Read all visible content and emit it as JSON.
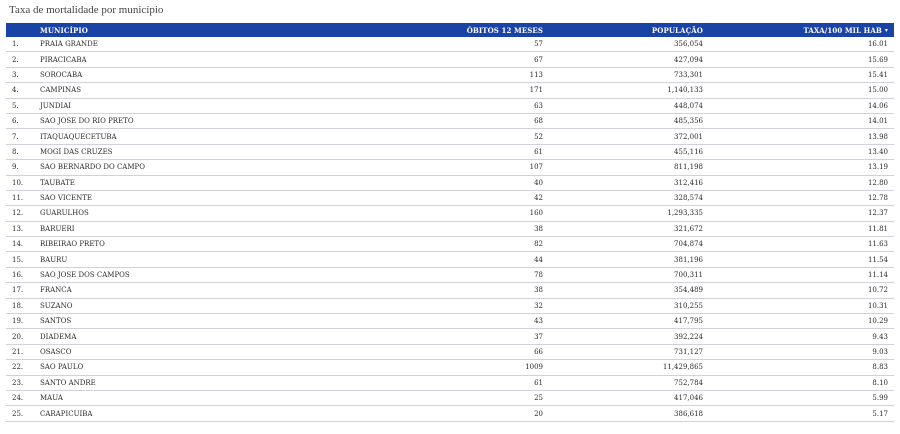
{
  "title": "Taxa de mortalidade por município",
  "table": {
    "headers": {
      "idx": "",
      "municipio": "MUNICÍPIO",
      "obitos": "ÓBITOS 12 MESES",
      "populacao": "POPULAÇÃO",
      "taxa": "TAXA/100 MIL HAB"
    },
    "sort_icon": "▾",
    "rows": [
      {
        "idx": "1.",
        "municipio": "PRAIA GRANDE",
        "obitos": "57",
        "populacao": "356,054",
        "taxa": "16.01"
      },
      {
        "idx": "2.",
        "municipio": "PIRACICABA",
        "obitos": "67",
        "populacao": "427,094",
        "taxa": "15.69"
      },
      {
        "idx": "3.",
        "municipio": "SOROCABA",
        "obitos": "113",
        "populacao": "733,301",
        "taxa": "15.41"
      },
      {
        "idx": "4.",
        "municipio": "CAMPINAS",
        "obitos": "171",
        "populacao": "1,140,133",
        "taxa": "15.00"
      },
      {
        "idx": "5.",
        "municipio": "JUNDIAI",
        "obitos": "63",
        "populacao": "448,074",
        "taxa": "14.06"
      },
      {
        "idx": "6.",
        "municipio": "SAO JOSE DO RIO PRETO",
        "obitos": "68",
        "populacao": "485,356",
        "taxa": "14.01"
      },
      {
        "idx": "7.",
        "municipio": "ITAQUAQUECETUBA",
        "obitos": "52",
        "populacao": "372,001",
        "taxa": "13.98"
      },
      {
        "idx": "8.",
        "municipio": "MOGI DAS CRUZES",
        "obitos": "61",
        "populacao": "455,116",
        "taxa": "13.40"
      },
      {
        "idx": "9.",
        "municipio": "SAO BERNARDO DO CAMPO",
        "obitos": "107",
        "populacao": "811,198",
        "taxa": "13.19"
      },
      {
        "idx": "10.",
        "municipio": "TAUBATE",
        "obitos": "40",
        "populacao": "312,416",
        "taxa": "12.80"
      },
      {
        "idx": "11.",
        "municipio": "SAO VICENTE",
        "obitos": "42",
        "populacao": "328,574",
        "taxa": "12.78"
      },
      {
        "idx": "12.",
        "municipio": "GUARULHOS",
        "obitos": "160",
        "populacao": "1,293,335",
        "taxa": "12.37"
      },
      {
        "idx": "13.",
        "municipio": "BARUERI",
        "obitos": "38",
        "populacao": "321,672",
        "taxa": "11.81"
      },
      {
        "idx": "14.",
        "municipio": "RIBEIRAO PRETO",
        "obitos": "82",
        "populacao": "704,874",
        "taxa": "11.63"
      },
      {
        "idx": "15.",
        "municipio": "BAURU",
        "obitos": "44",
        "populacao": "381,196",
        "taxa": "11.54"
      },
      {
        "idx": "16.",
        "municipio": "SAO JOSE DOS CAMPOS",
        "obitos": "78",
        "populacao": "700,311",
        "taxa": "11.14"
      },
      {
        "idx": "17.",
        "municipio": "FRANCA",
        "obitos": "38",
        "populacao": "354,489",
        "taxa": "10.72"
      },
      {
        "idx": "18.",
        "municipio": "SUZANO",
        "obitos": "32",
        "populacao": "310,255",
        "taxa": "10.31"
      },
      {
        "idx": "19.",
        "municipio": "SANTOS",
        "obitos": "43",
        "populacao": "417,795",
        "taxa": "10.29"
      },
      {
        "idx": "20.",
        "municipio": "DIADEMA",
        "obitos": "37",
        "populacao": "392,224",
        "taxa": "9.43"
      },
      {
        "idx": "21.",
        "municipio": "OSASCO",
        "obitos": "66",
        "populacao": "731,127",
        "taxa": "9.03"
      },
      {
        "idx": "22.",
        "municipio": "SAO PAULO",
        "obitos": "1009",
        "populacao": "11,429,865",
        "taxa": "8.83"
      },
      {
        "idx": "23.",
        "municipio": "SANTO ANDRE",
        "obitos": "61",
        "populacao": "752,784",
        "taxa": "8.10"
      },
      {
        "idx": "24.",
        "municipio": "MAUA",
        "obitos": "25",
        "populacao": "417,046",
        "taxa": "5.99"
      },
      {
        "idx": "25.",
        "municipio": "CARAPICUIBA",
        "obitos": "20",
        "populacao": "386,618",
        "taxa": "5.17"
      }
    ]
  }
}
